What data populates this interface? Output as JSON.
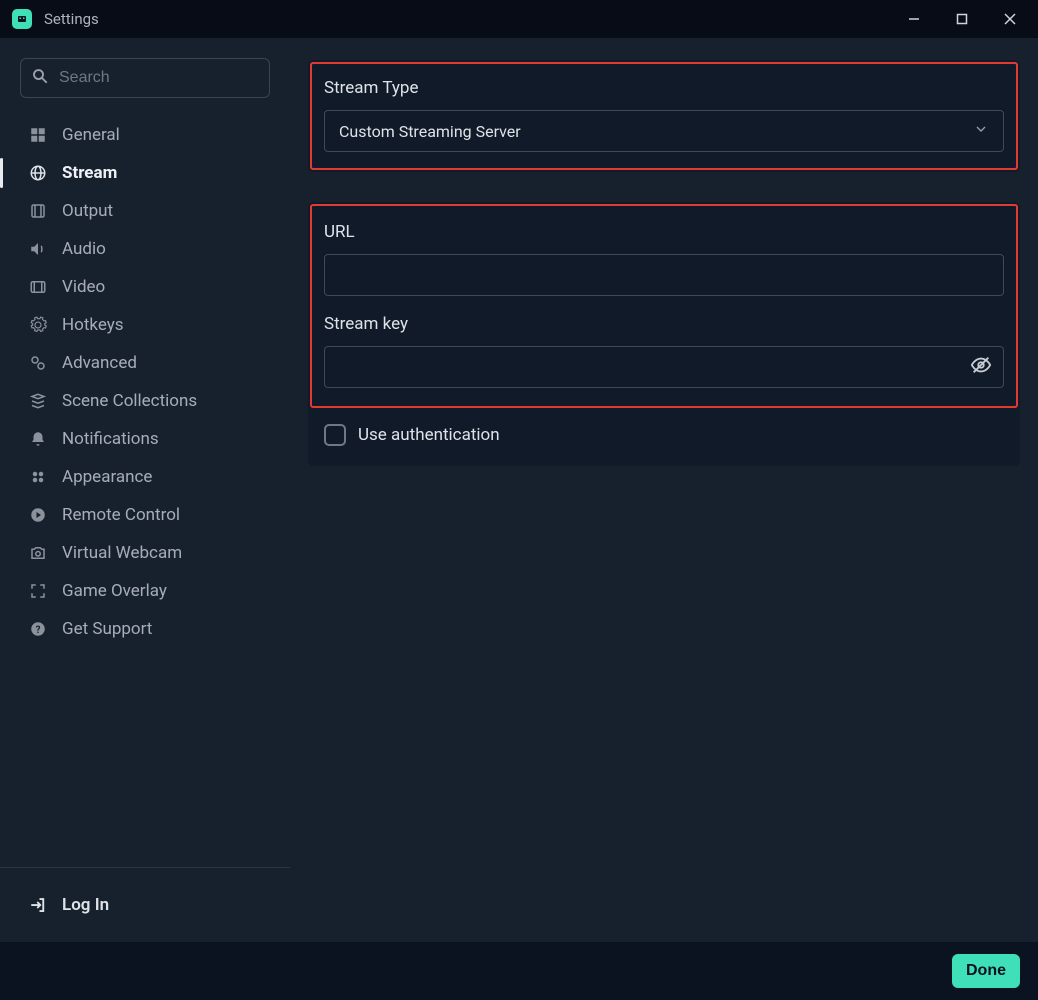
{
  "titlebar": {
    "title": "Settings"
  },
  "search": {
    "placeholder": "Search"
  },
  "sidebar": {
    "items": [
      {
        "label": "General"
      },
      {
        "label": "Stream"
      },
      {
        "label": "Output"
      },
      {
        "label": "Audio"
      },
      {
        "label": "Video"
      },
      {
        "label": "Hotkeys"
      },
      {
        "label": "Advanced"
      },
      {
        "label": "Scene Collections"
      },
      {
        "label": "Notifications"
      },
      {
        "label": "Appearance"
      },
      {
        "label": "Remote Control"
      },
      {
        "label": "Virtual Webcam"
      },
      {
        "label": "Game Overlay"
      },
      {
        "label": "Get Support"
      }
    ],
    "login_label": "Log In"
  },
  "panel_stream_type": {
    "label": "Stream Type",
    "value": "Custom Streaming Server"
  },
  "panel_server": {
    "url_label": "URL",
    "url_value": "",
    "key_label": "Stream key",
    "key_value": ""
  },
  "auth": {
    "checkbox_label": "Use authentication",
    "checked": false
  },
  "footer": {
    "done_label": "Done"
  }
}
